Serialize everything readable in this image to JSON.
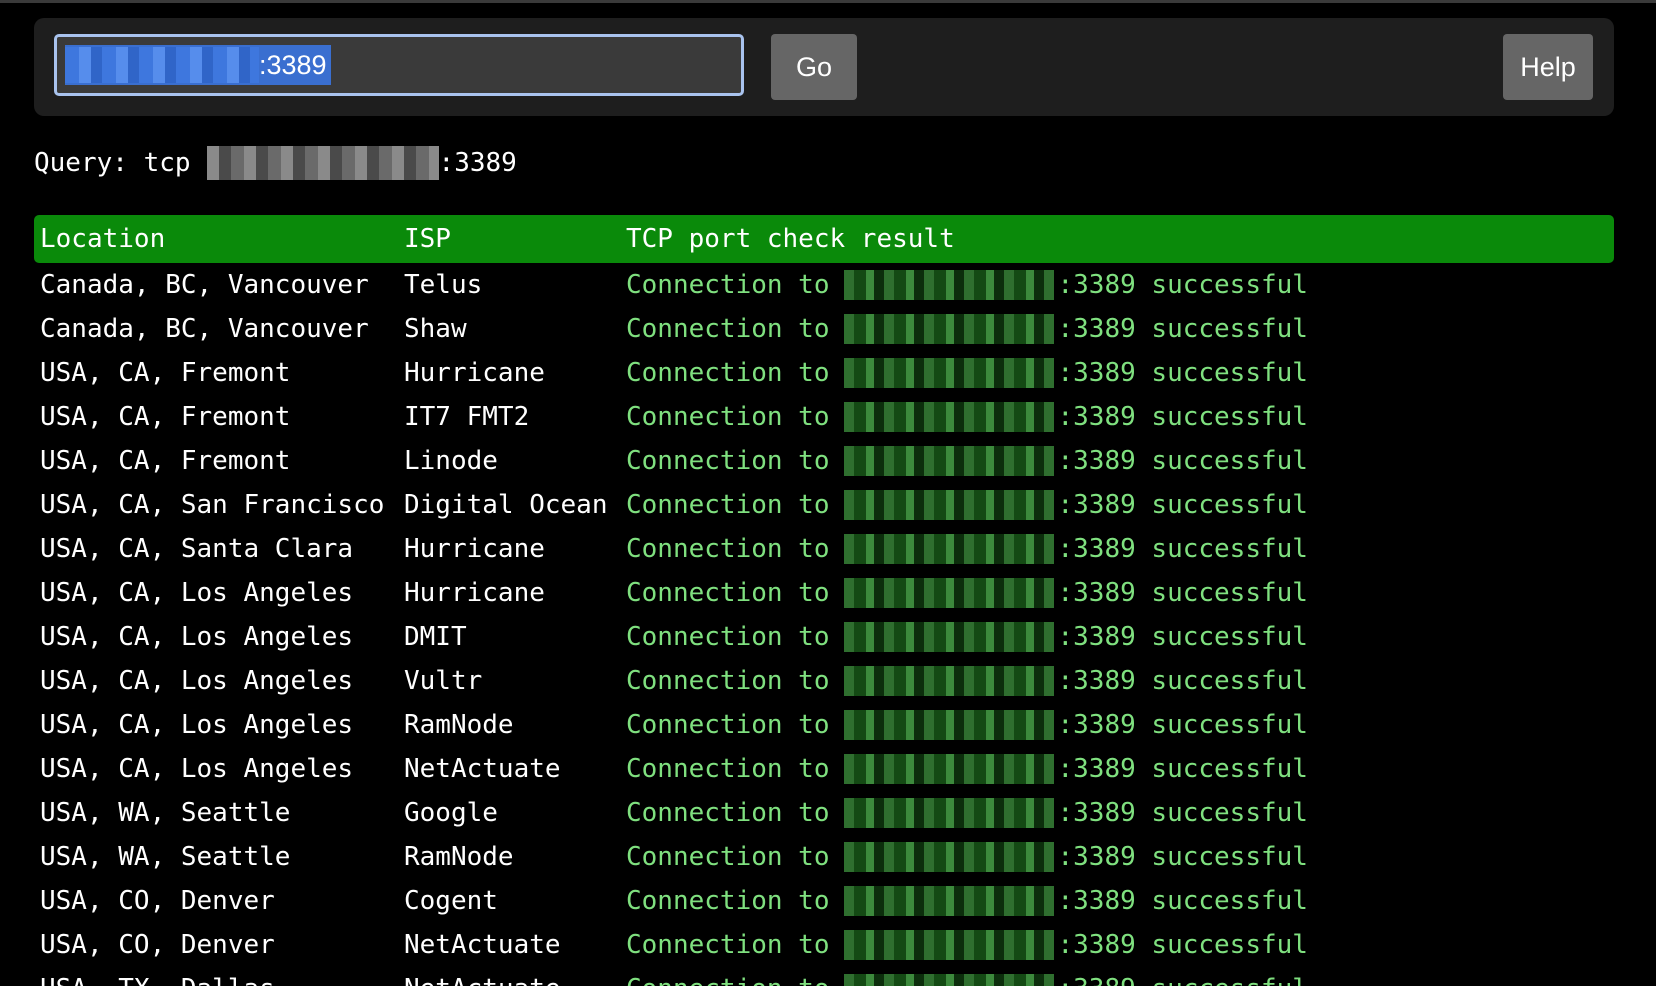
{
  "toolbar": {
    "query_value": ":3389",
    "go_label": "Go",
    "help_label": "Help"
  },
  "query": {
    "prefix": "Query: tcp",
    "suffix": ":3389"
  },
  "table": {
    "headers": [
      "Location",
      "ISP",
      "TCP port check result"
    ],
    "result_prefix": "Connection to",
    "result_suffix": ":3389 successful",
    "rows": [
      {
        "location": "Canada, BC, Vancouver",
        "isp": "Telus"
      },
      {
        "location": "Canada, BC, Vancouver",
        "isp": "Shaw"
      },
      {
        "location": "USA, CA, Fremont",
        "isp": "Hurricane"
      },
      {
        "location": "USA, CA, Fremont",
        "isp": "IT7 FMT2"
      },
      {
        "location": "USA, CA, Fremont",
        "isp": "Linode"
      },
      {
        "location": "USA, CA, San Francisco",
        "isp": "Digital Ocean"
      },
      {
        "location": "USA, CA, Santa Clara",
        "isp": "Hurricane"
      },
      {
        "location": "USA, CA, Los Angeles",
        "isp": "Hurricane"
      },
      {
        "location": "USA, CA, Los Angeles",
        "isp": "DMIT"
      },
      {
        "location": "USA, CA, Los Angeles",
        "isp": "Vultr"
      },
      {
        "location": "USA, CA, Los Angeles",
        "isp": "RamNode"
      },
      {
        "location": "USA, CA, Los Angeles",
        "isp": "NetActuate"
      },
      {
        "location": "USA, WA, Seattle",
        "isp": "Google"
      },
      {
        "location": "USA, WA, Seattle",
        "isp": "RamNode"
      },
      {
        "location": "USA, CO, Denver",
        "isp": "Cogent"
      },
      {
        "location": "USA, CO, Denver",
        "isp": "NetActuate"
      },
      {
        "location": "USA, TX, Dallas",
        "isp": "NetActuate"
      }
    ]
  }
}
